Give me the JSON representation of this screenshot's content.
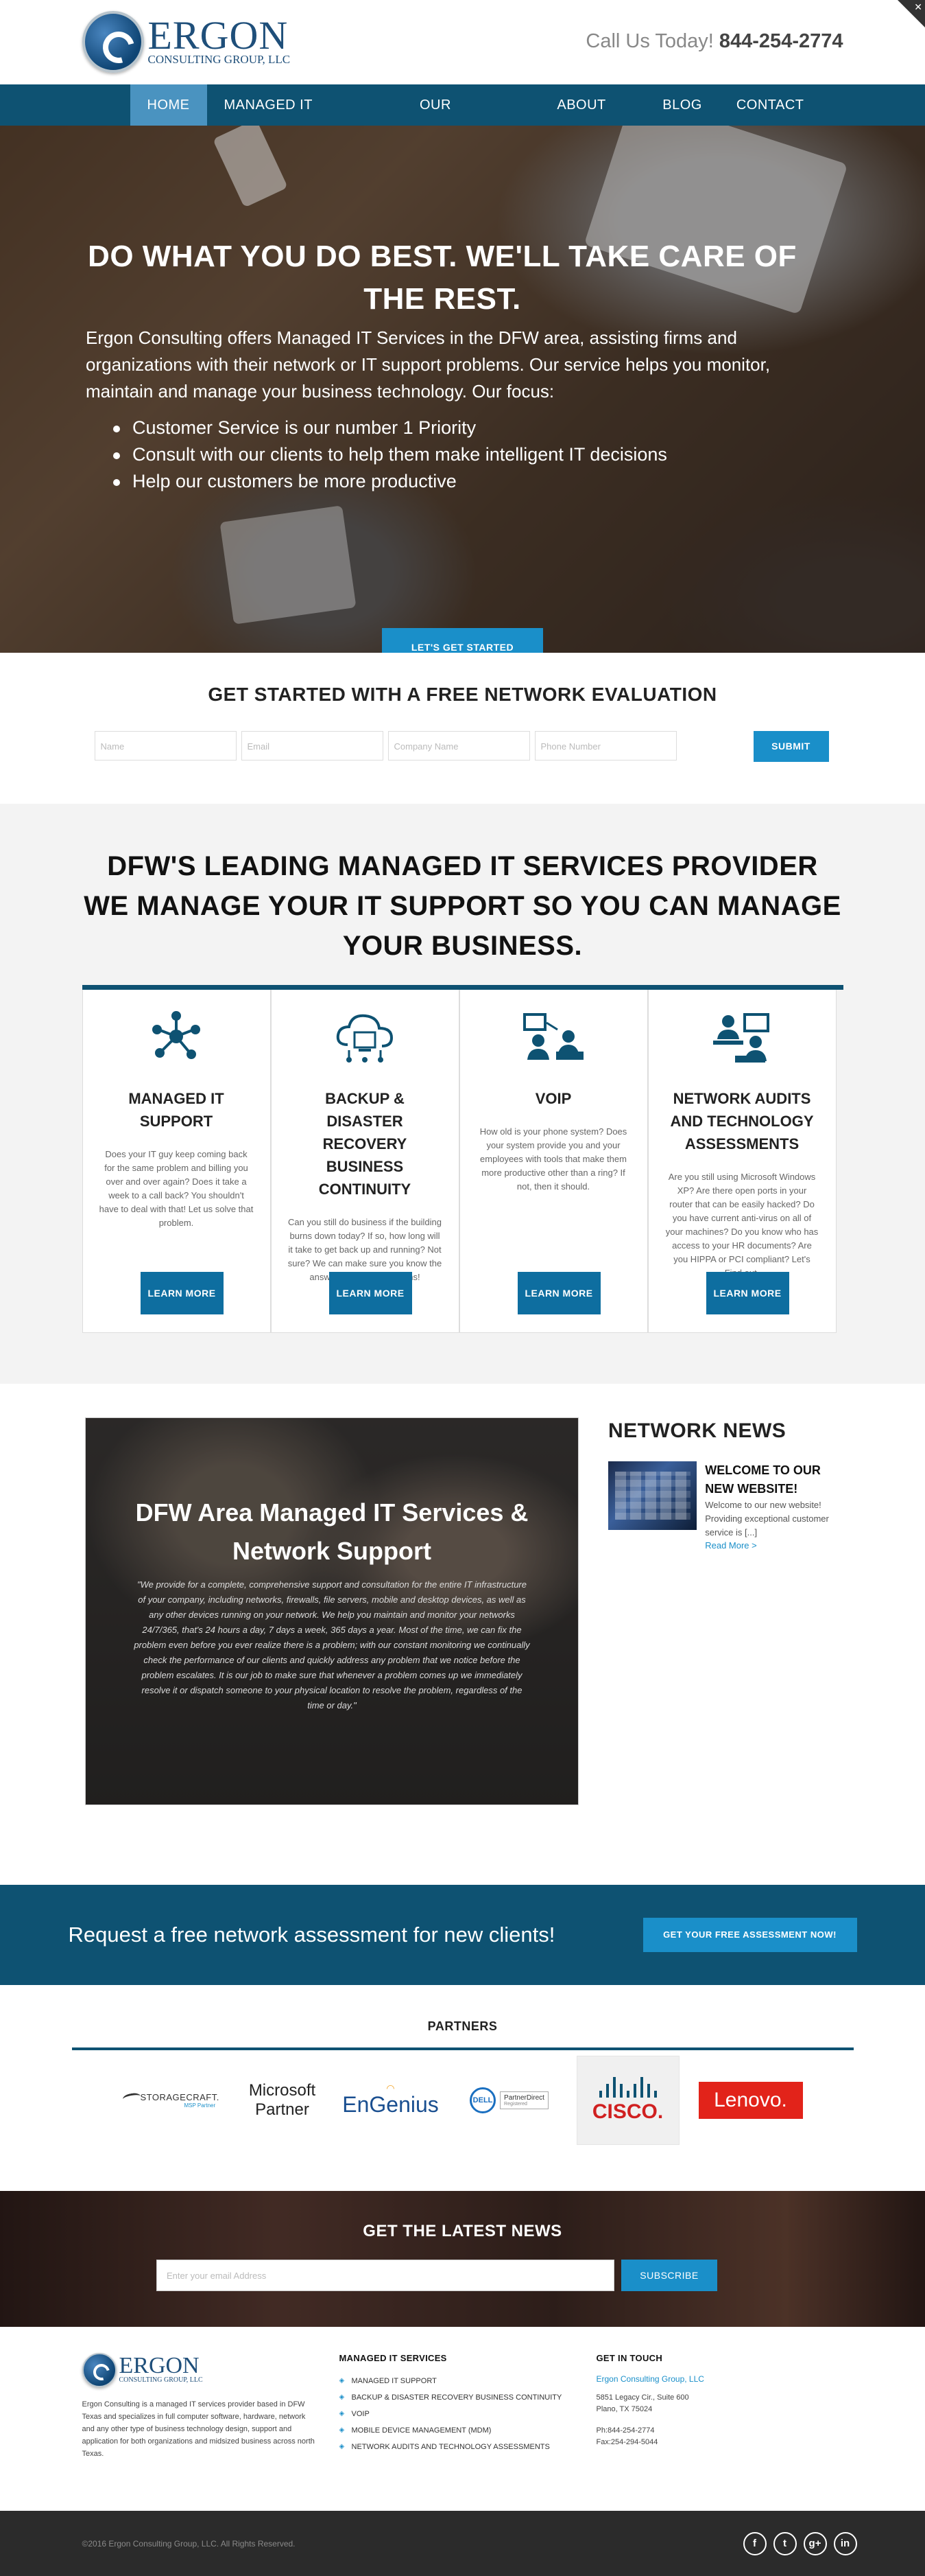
{
  "header": {
    "logo_name": "ERGON",
    "logo_sub": "CONSULTING GROUP, LLC",
    "call_label": "Call Us Today!",
    "phone": "844-254-2774"
  },
  "nav": {
    "items": [
      "HOME",
      "MANAGED IT SERVICES",
      "OUR PROCESS",
      "ABOUT US",
      "BLOG",
      "CONTACT US"
    ],
    "active": "HOME"
  },
  "hero": {
    "title": "DO WHAT YOU DO BEST. WE'LL TAKE CARE OF THE REST.",
    "intro": "Ergon Consulting offers Managed IT Services in the DFW area, assisting firms and organizations with their network or IT support problems. Our service helps you monitor, maintain and manage your business technology. Our focus:",
    "bullets": [
      "Customer Service is our number 1 Priority",
      "Consult with our clients to help them make intelligent IT decisions",
      "Help our customers be more productive"
    ],
    "cta": "LET'S GET STARTED"
  },
  "evaluation": {
    "title": "GET STARTED WITH A FREE NETWORK EVALUATION",
    "name_placeholder": "Name",
    "email_placeholder": "Email",
    "company_placeholder": "Company Name",
    "phone_placeholder": "Phone Number",
    "submit": "SUBMIT"
  },
  "leading": {
    "line1": "DFW'S LEADING MANAGED IT SERVICES PROVIDER",
    "line2": "WE MANAGE YOUR IT SUPPORT SO YOU CAN MANAGE YOUR BUSINESS.",
    "cards": [
      {
        "icon": "network-icon",
        "title": "MANAGED IT SUPPORT",
        "text": "Does your IT guy keep coming back for the same problem and billing you over and over again? Does it take a week to a call back? You shouldn't have to deal with that! Let us solve that problem.",
        "button": "LEARN MORE"
      },
      {
        "icon": "cloud-backup-icon",
        "title": "BACKUP & DISASTER RECOVERY BUSINESS CONTINUITY",
        "text": "Can you still do business if the building burns down today? If so, how long will it take to get back up and running? Not sure? We can make sure you know the answers to these questions!",
        "button": "LEARN MORE"
      },
      {
        "icon": "voip-icon",
        "title": "VOIP",
        "text": "How old is your phone system? Does your system provide you and your employees with tools that make them more productive other than a ring? If not, then it should.",
        "button": "LEARN MORE"
      },
      {
        "icon": "audit-icon",
        "title": "NETWORK AUDITS AND TECHNOLOGY ASSESSMENTS",
        "text": "Are you still using Microsoft Windows XP? Are there open ports in your router that can be easily hacked? Do you have current anti-virus on all of your machines? Do you know who has access to your HR documents? Are you HIPPA or PCI compliant? Let's Find out.",
        "button": "LEARN MORE"
      }
    ]
  },
  "promo": {
    "title": "DFW Area Managed IT Services & Network Support",
    "quote": "\"We provide for a complete, comprehensive support and consultation for the entire IT infrastructure of your company, including networks, firewalls, file servers, mobile and desktop devices, as well as any other devices running on your network. We help you maintain and monitor your networks 24/7/365, that's 24 hours a day, 7 days a week, 365 days a year. Most of the time, we can fix the problem even before you ever realize there is a problem; with our constant monitoring we continually check the performance of our clients and quickly address any problem that we notice before the problem escalates. It is our job to make sure that whenever a problem comes up we immediately resolve it or dispatch someone to your physical location to resolve the problem, regardless of the time or day.\""
  },
  "network_news": {
    "title": "NETWORK NEWS",
    "post_title": "WELCOME TO OUR NEW WEBSITE!",
    "post_excerpt": "Welcome to our new website! Providing exceptional customer service is [...]",
    "read_more": "Read More >"
  },
  "request_bar": {
    "text": "Request a free network assessment for new clients!",
    "button": "GET YOUR FREE ASSESSMENT NOW!"
  },
  "partners": {
    "title": "PARTNERS",
    "storagecraft": "STORAGECRAFT.",
    "storagecraft_sub": "MSP Partner",
    "microsoft": "Microsoft",
    "microsoft_sub": "Partner",
    "engenius": "EnGenius",
    "dell": "DELL",
    "dell_partner": "PartnerDirect",
    "dell_partner_sub": "Registered",
    "cisco": "CISCO.",
    "lenovo": "Lenovo."
  },
  "latest": {
    "title": "GET THE LATEST NEWS",
    "email_placeholder": "Enter your email Address",
    "button": "SUBSCRIBE"
  },
  "footer": {
    "description": "Ergon Consulting is a managed IT services provider based in DFW Texas and specializes in full computer software, hardware, network and any other type of business technology design, support and application for both organizations and midsized business across north Texas.",
    "services_title": "MANAGED IT SERVICES",
    "services": [
      "MANAGED IT SUPPORT",
      "BACKUP & DISASTER RECOVERY BUSINESS CONTINUITY",
      "VOIP",
      "MOBILE DEVICE MANAGEMENT (MDM)",
      "NETWORK AUDITS AND TECHNOLOGY ASSESSMENTS"
    ],
    "contact_title": "GET IN TOUCH",
    "company": "Ergon Consulting Group, LLC",
    "address1": "5851 Legacy Cir., Suite 600",
    "address2": "Plano, TX 75024",
    "phone": "Ph:844-254-2774",
    "fax": "Fax:254-294-5044"
  },
  "bottom": {
    "copyright": "©2016 Ergon Consulting Group, LLC. All Rights Reserved.",
    "social": [
      "f",
      "t",
      "g+",
      "in"
    ]
  },
  "colors": {
    "navy": "#0e5272",
    "accent": "#1a8fc9",
    "active_nav": "#4a93c0"
  }
}
